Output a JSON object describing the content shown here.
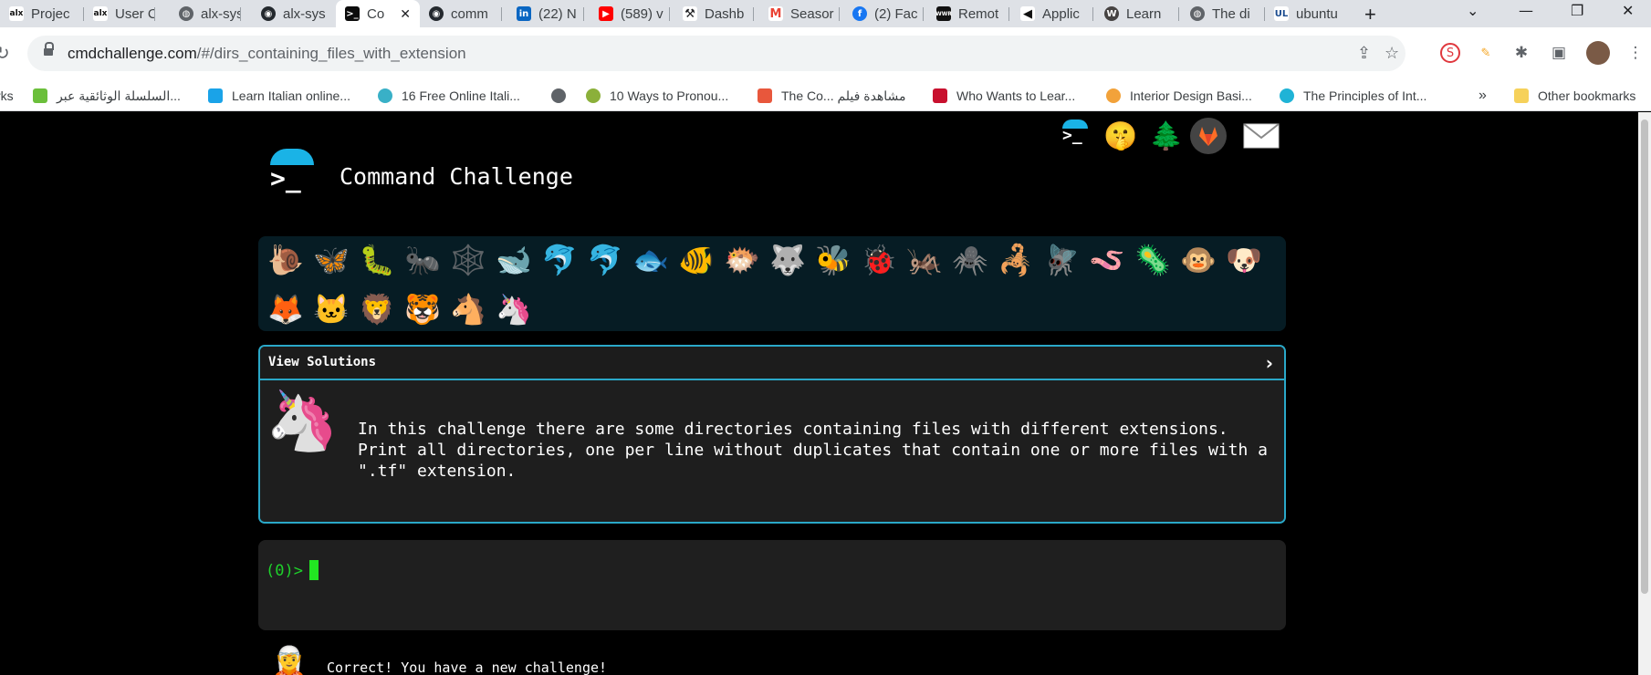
{
  "tabs": [
    {
      "label": "Projec",
      "icon": "alx-icon"
    },
    {
      "label": "User C",
      "icon": "alx-icon"
    },
    {
      "label": "alx-sys",
      "icon": "globe-icon"
    },
    {
      "label": "alx-sys",
      "icon": "github-icon"
    },
    {
      "label": "Co",
      "icon": "terminal-icon",
      "active": true
    },
    {
      "label": "comm",
      "icon": "github-icon"
    },
    {
      "label": "(22) N",
      "icon": "linkedin-icon"
    },
    {
      "label": "(589) v",
      "icon": "youtube-icon"
    },
    {
      "label": "Dashb",
      "icon": "tools-icon"
    },
    {
      "label": "Seasor",
      "icon": "gmail-icon"
    },
    {
      "label": "(2) Fac",
      "icon": "facebook-icon"
    },
    {
      "label": "Remot",
      "icon": "wwr-icon"
    },
    {
      "label": "Applic",
      "icon": "megaphone-icon"
    },
    {
      "label": "Learn",
      "icon": "wordpress-icon"
    },
    {
      "label": "The di",
      "icon": "globe-icon"
    },
    {
      "label": "ubuntu",
      "icon": "ul-icon"
    }
  ],
  "address": {
    "domain": "cmdchallenge.com",
    "path": "/#/dirs_containing_files_with_extension"
  },
  "bookmarks": [
    {
      "label": "rks"
    },
    {
      "label": "السلسلة الوثائقية عبر..."
    },
    {
      "label": "Learn Italian online..."
    },
    {
      "label": "16 Free Online Itali..."
    },
    {
      "label": ""
    },
    {
      "label": "10 Ways to Pronou..."
    },
    {
      "label": "The Co... مشاهدة فيلم"
    },
    {
      "label": "Who Wants to Lear..."
    },
    {
      "label": "Interior Design Basi..."
    },
    {
      "label": "The Principles of Int..."
    },
    {
      "label": "»"
    },
    {
      "label": "Other bookmarks"
    }
  ],
  "page": {
    "title": "Command Challenge",
    "logo_prompt": ">_",
    "header_icons": [
      "terminal-icon",
      "shushing-face-icon",
      "tree-icon",
      "gitlab-icon",
      "envelope-icon"
    ],
    "levels": [
      "🐌",
      "🦋",
      "🐛",
      "🐜",
      "🕸️",
      "🐋",
      "🐬",
      "🐬",
      "🐟",
      "🐠",
      "🐡",
      "🐺",
      "🐝",
      "🐞",
      "🦗",
      "🕷️",
      "🦂",
      "🪰",
      "🪱",
      "🦠",
      "🐵",
      "🐶",
      "🦊",
      "🐱",
      "🦁",
      "🐯",
      "🐴",
      "🦄"
    ],
    "solutions_label": "View Solutions",
    "chevron": "›",
    "description": "In this challenge there are some directories containing files with different extensions.\nPrint all directories, one per line without duplicates that contain one or more files with a\n\".tf\" extension.",
    "prompt": "(0)>",
    "message": "Correct! You have a new challenge!"
  },
  "colors": {
    "accent": "#2aa8c8",
    "logo_cap": "#1ab3e6",
    "prompt_green": "#1fd12b"
  }
}
